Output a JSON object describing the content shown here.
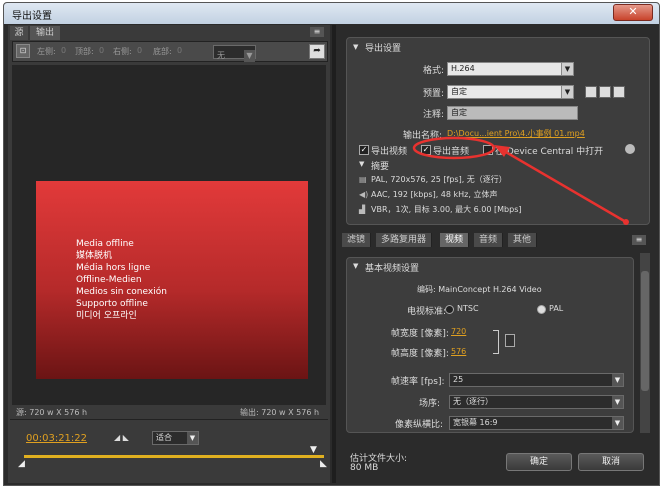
{
  "window": {
    "title": "导出设置",
    "close": "✕"
  },
  "left": {
    "tabs": [
      "源",
      "输出"
    ],
    "crop": {
      "left_label": "左侧:",
      "left_val": "0",
      "top_label": "顶部:",
      "top_val": "0",
      "right_label": "右侧:",
      "right_val": "0",
      "bottom_label": "底部:",
      "bottom_val": "0",
      "mode": "无"
    },
    "offline_lines": [
      "Media offline",
      "媒体脱机",
      "Média hors ligne",
      "Offline-Medien",
      "Medios sin conexión",
      "Supporto offline",
      "미디어 오프라인"
    ],
    "source_info": "源: 720 w X 576 h",
    "output_info": "输出: 720 w X 576 h",
    "timecode": "00:03:21:22",
    "fit": "适合"
  },
  "export": {
    "group_title": "导出设置",
    "format_label": "格式:",
    "format_value": "H.264",
    "preset_label": "预置:",
    "preset_value": "自定",
    "comment_label": "注释:",
    "comment_value": "自定",
    "output_name_label": "输出名称:",
    "output_name_value": "D:\\Docu...ient Pro\\4.小事例 01.mp4",
    "export_video": "导出视频",
    "export_audio": "导出音频",
    "device_central": "在 Device Central 中打开",
    "summary_title": "摘要",
    "summary_lines": [
      "PAL, 720x576, 25 [fps], 无（逐行）",
      "AAC, 192 [kbps], 48 kHz, 立体声",
      "VBR，1次, 目标 3.00, 最大 6.00 [Mbps]"
    ]
  },
  "tabs": [
    "滤镜",
    "多路复用器",
    "视频",
    "音频",
    "其他"
  ],
  "video": {
    "section": "基本视频设置",
    "codec": "编码: MainConcept H.264 Video",
    "tv_label": "电视标准:",
    "ntsc": "NTSC",
    "pal": "PAL",
    "width_label": "帧宽度 [像素]:",
    "width": "720",
    "height_label": "帧高度 [像素]:",
    "height": "576",
    "fps_label": "帧速率 [fps]:",
    "fps": "25",
    "field_label": "场序:",
    "field": "无（逐行）",
    "aspect_label": "像素纵横比:",
    "aspect": "宽银幕 16:9"
  },
  "footer": {
    "size_label": "估计文件大小:",
    "size_value": "80 MB",
    "ok": "确定",
    "cancel": "取消"
  },
  "colors": {
    "accent": "#e8322f",
    "link": "#e0a020",
    "timecode": "#e0a020"
  }
}
